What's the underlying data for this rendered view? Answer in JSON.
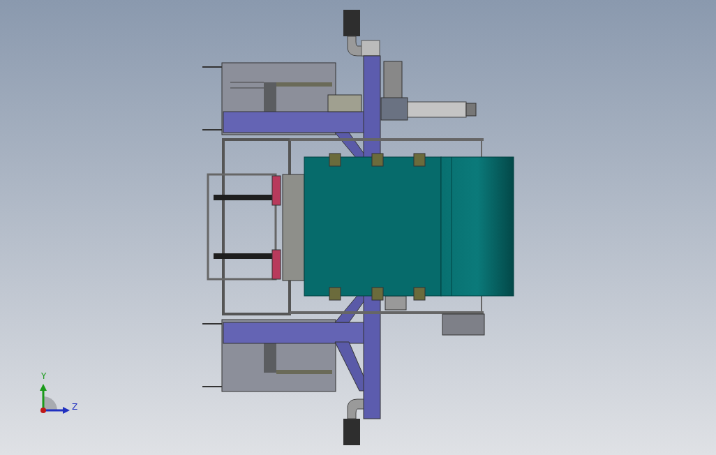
{
  "viewport": {
    "triad": {
      "axes": [
        {
          "kind": "vertical",
          "label": "Y"
        },
        {
          "kind": "horizontal",
          "label": "Z"
        }
      ]
    }
  }
}
